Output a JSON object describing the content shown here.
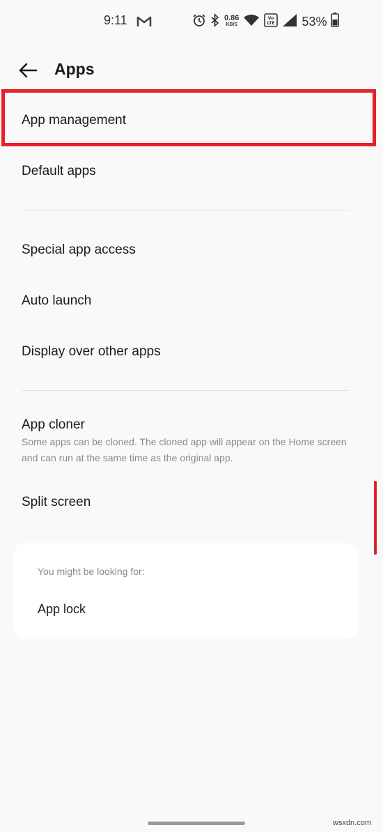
{
  "status_bar": {
    "time": "9:11",
    "net_speed": "0.86",
    "net_unit": "KB/S",
    "volte": "Vo LTE",
    "battery": "53%",
    "icons": [
      "gmail-icon",
      "alarm-icon",
      "bluetooth-icon",
      "wifi-icon",
      "signal-icon",
      "battery-icon"
    ]
  },
  "header": {
    "title": "Apps",
    "back_icon": "back-arrow-icon"
  },
  "items": {
    "app_management": "App management",
    "default_apps": "Default apps",
    "special_app_access": "Special app access",
    "auto_launch": "Auto launch",
    "display_over_other_apps": "Display over other apps",
    "app_cloner": "App cloner",
    "app_cloner_desc": "Some apps can be cloned. The cloned app will appear on the Home screen and can run at the same time as the original app.",
    "split_screen": "Split screen"
  },
  "suggestions": {
    "label": "You might be looking for:",
    "items": [
      "App lock"
    ]
  },
  "watermark": "wsxdn.com",
  "colors": {
    "highlight": "#e8202a",
    "background": "#f9f9f9",
    "accent": "#d9262e"
  }
}
